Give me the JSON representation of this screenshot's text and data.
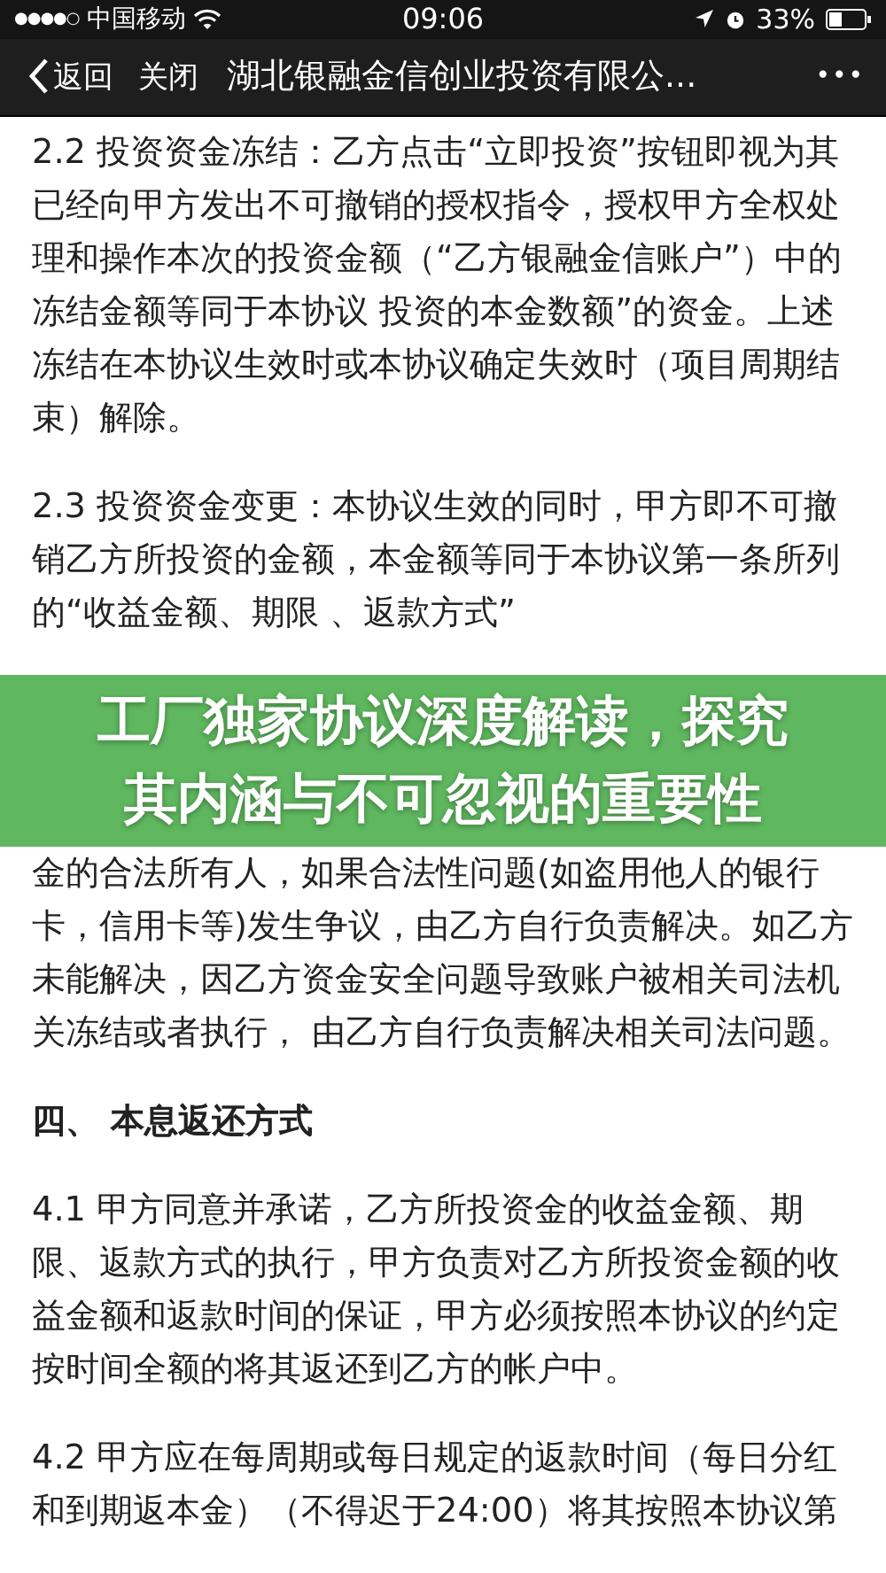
{
  "status_bar": {
    "signal": "●●●●○",
    "carrier": "中国移动",
    "time": "09:06",
    "battery": "33%"
  },
  "nav_bar": {
    "back": "返回",
    "close": "关闭",
    "title": "湖北银融金信创业投资有限公...",
    "more": "•••"
  },
  "content": [
    {
      "kind": "paragraph",
      "text": "2.2 投资资金冻结：乙方点击“立即投资”按钮即视为其已经向甲方发出不可撤销的授权指令，授权甲方全权处理和操作本次的投资金额（“乙方银融金信账户”）中的冻结金额等同于本协议 投资的本金数额”的资金。上述冻结在本协议生效时或本协议确定失效时（项目周期结束）解除。"
    },
    {
      "kind": "paragraph",
      "text": "2.3 投资资金变更：本协议生效的同时，甲方即不可撤销乙方所投资的金额，本金额等同于本协议第一条所列的“收益金额、期限 、返款方式”"
    },
    {
      "kind": "banner",
      "title": "工厂独家协议深度解读，探究其内涵与不可忽视的重要性"
    },
    {
      "kind": "paragraph",
      "text": "金的合法所有人，如果合法性问题(如盗用他人的银行卡，信用卡等)发生争议，由乙方自行负责解决。如乙方未能解决，因乙方资金安全问题导致账户被相关司法机关冻结或者执行， 由乙方自行负责解决相关司法问题。"
    },
    {
      "kind": "heading",
      "text": "四、 本息返还方式"
    },
    {
      "kind": "paragraph",
      "text": "4.1 甲方同意并承诺，乙方所投资金的收益金额、期限、返款方式的执行，甲方负责对乙方所投资金额的收益金额和返款时间的保证，甲方必须按照本协议的约定按时间全额的将其返还到乙方的帐户中。"
    },
    {
      "kind": "paragraph",
      "text": "4.2 甲方应在每周期或每日规定的返款时间（每日分红和到期返本金）（不得迟于24:00）将其按照本协议第"
    }
  ]
}
